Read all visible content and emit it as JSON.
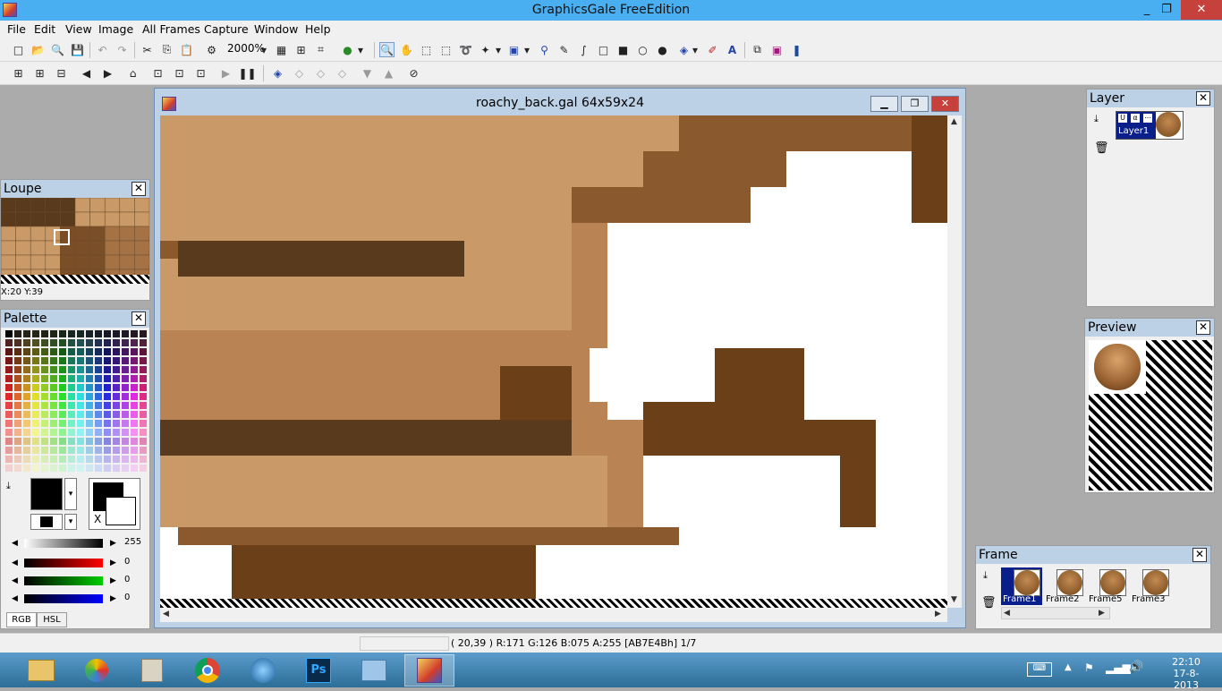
{
  "app": {
    "title": "GraphicsGale FreeEdition",
    "window_controls": {
      "minimize": "_",
      "maximize": "❐",
      "close": "✕"
    }
  },
  "menu": [
    "File",
    "Edit",
    "View",
    "Image",
    "All Frames",
    "Capture",
    "Window",
    "Help"
  ],
  "toolbar": {
    "zoom_value": "2000%"
  },
  "document": {
    "title": "roachy_back.gal 64x59x24"
  },
  "loupe": {
    "title": "Loupe",
    "coords": "X:20 Y:39"
  },
  "palette": {
    "title": "Palette",
    "swap_label": "X",
    "gray_value": "255",
    "red_value": "0",
    "green_value": "0",
    "blue_value": "0",
    "tabs": [
      "RGB",
      "HSL"
    ]
  },
  "layer_panel": {
    "title": "Layer",
    "layer_name": "Layer1"
  },
  "preview_panel": {
    "title": "Preview"
  },
  "frame_panel": {
    "title": "Frame",
    "frames": [
      "Frame1",
      "Frame2",
      "Frame5",
      "Frame3"
    ]
  },
  "status": {
    "pixel_info": "( 20,39 ) R:171 G:126 B:075 A:255  [AB7E4Bh]  1/7"
  },
  "taskbar": {
    "time": "22:10",
    "date": "17-8-2013"
  },
  "canvas_colors": {
    "light": "#c99a68",
    "mid": "#b98353",
    "dark": "#8a5a2e",
    "darker": "#6b4018",
    "shadow": "#5a3a1c"
  }
}
